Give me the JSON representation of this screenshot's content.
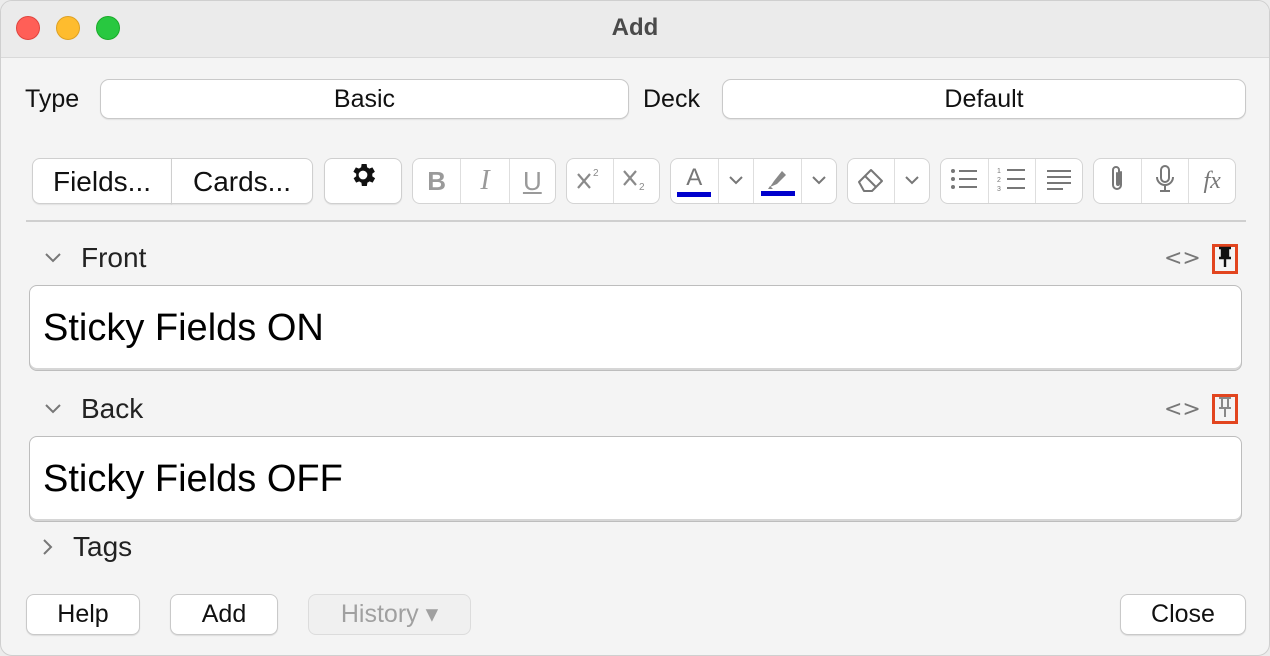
{
  "window": {
    "title": "Add"
  },
  "header": {
    "type_label": "Type",
    "type_value": "Basic",
    "deck_label": "Deck",
    "deck_value": "Default"
  },
  "toolbar": {
    "fields_label": "Fields...",
    "cards_label": "Cards...",
    "settings_icon": "gear-icon",
    "format_icons": [
      "bold-icon",
      "italic-icon",
      "underline-icon",
      "superscript-icon",
      "subscript-icon",
      "text-color-icon",
      "highlight-color-icon",
      "eraser-icon",
      "bullet-list-icon",
      "numbered-list-icon",
      "align-icon",
      "attachment-icon",
      "microphone-icon",
      "formula-icon"
    ],
    "bold_glyph": "B",
    "italic_glyph": "I",
    "underline_glyph": "U",
    "text_color_glyph": "A",
    "formula_glyph": "fx",
    "accent_color": "#0000cc"
  },
  "fields": [
    {
      "label": "Front",
      "value": "Sticky Fields ON",
      "pinned": true
    },
    {
      "label": "Back",
      "value": "Sticky Fields OFF",
      "pinned": false
    }
  ],
  "code_glyph": "<>",
  "tags": {
    "label": "Tags"
  },
  "buttons": {
    "help": "Help",
    "add": "Add",
    "history": "History ▾",
    "close": "Close"
  },
  "highlight_color": "#e2451f"
}
